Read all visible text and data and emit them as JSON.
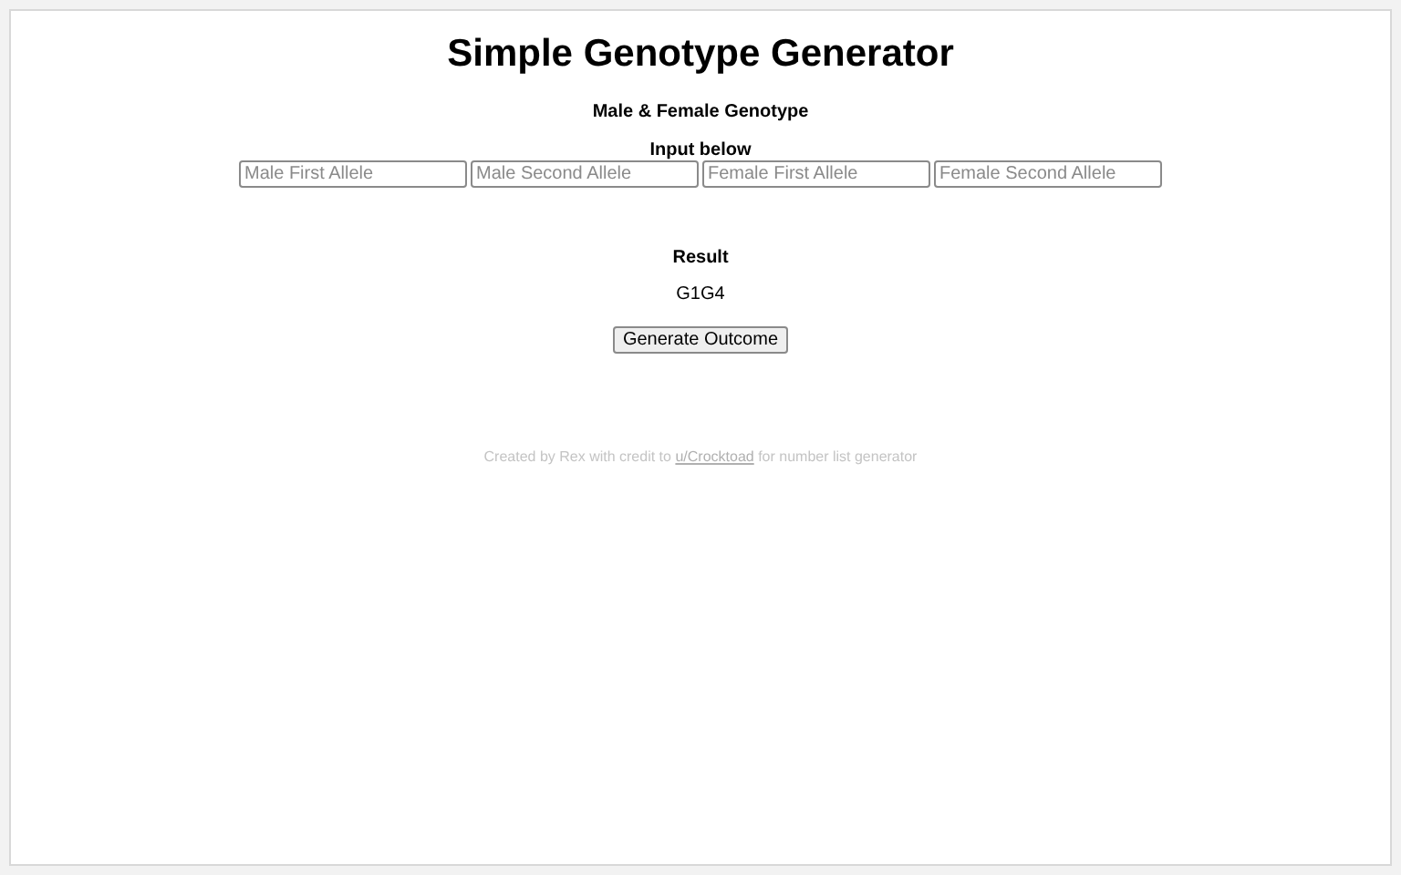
{
  "title": "Simple Genotype Generator",
  "subtitle": "Male & Female Genotype",
  "input_label": "Input below",
  "fields": [
    {
      "placeholder": "Male First Allele"
    },
    {
      "placeholder": "Male Second Allele"
    },
    {
      "placeholder": "Female First Allele"
    },
    {
      "placeholder": "Female Second Allele"
    }
  ],
  "result_label": "Result",
  "result": "G1G4",
  "button": "Generate Outcome",
  "footer": {
    "before": "Created by Rex with credit to ",
    "link": "u/Crocktoad",
    "after": " for number list generator"
  }
}
